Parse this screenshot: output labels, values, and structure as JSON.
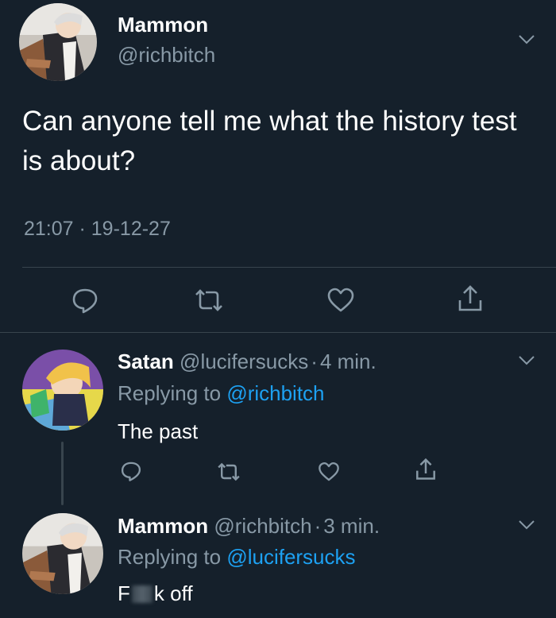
{
  "main_tweet": {
    "display_name": "Mammon",
    "handle": "@richbitch",
    "text": "Can anyone tell me what the history test is about?",
    "timestamp": "21:07 · 19-12-27"
  },
  "replies": [
    {
      "display_name": "Satan",
      "handle": "@lucifersucks",
      "sep": "·",
      "time": "4 min.",
      "replying_prefix": "Replying to",
      "replying_to": "@richbitch",
      "text": "The past"
    },
    {
      "display_name": "Mammon",
      "handle": "@richbitch",
      "sep": "·",
      "time": "3 min.",
      "replying_prefix": "Replying to",
      "replying_to": "@lucifersucks",
      "text_start": "F",
      "text_end": "k off"
    }
  ],
  "icons": {
    "reply": "reply-icon",
    "retweet": "retweet-icon",
    "like": "heart-icon",
    "share": "share-icon",
    "menu": "chevron-down-icon"
  },
  "colors": {
    "background": "#15202b",
    "text": "#ffffff",
    "muted": "#8899a6",
    "link": "#1da1f2",
    "divider": "#38444d"
  }
}
